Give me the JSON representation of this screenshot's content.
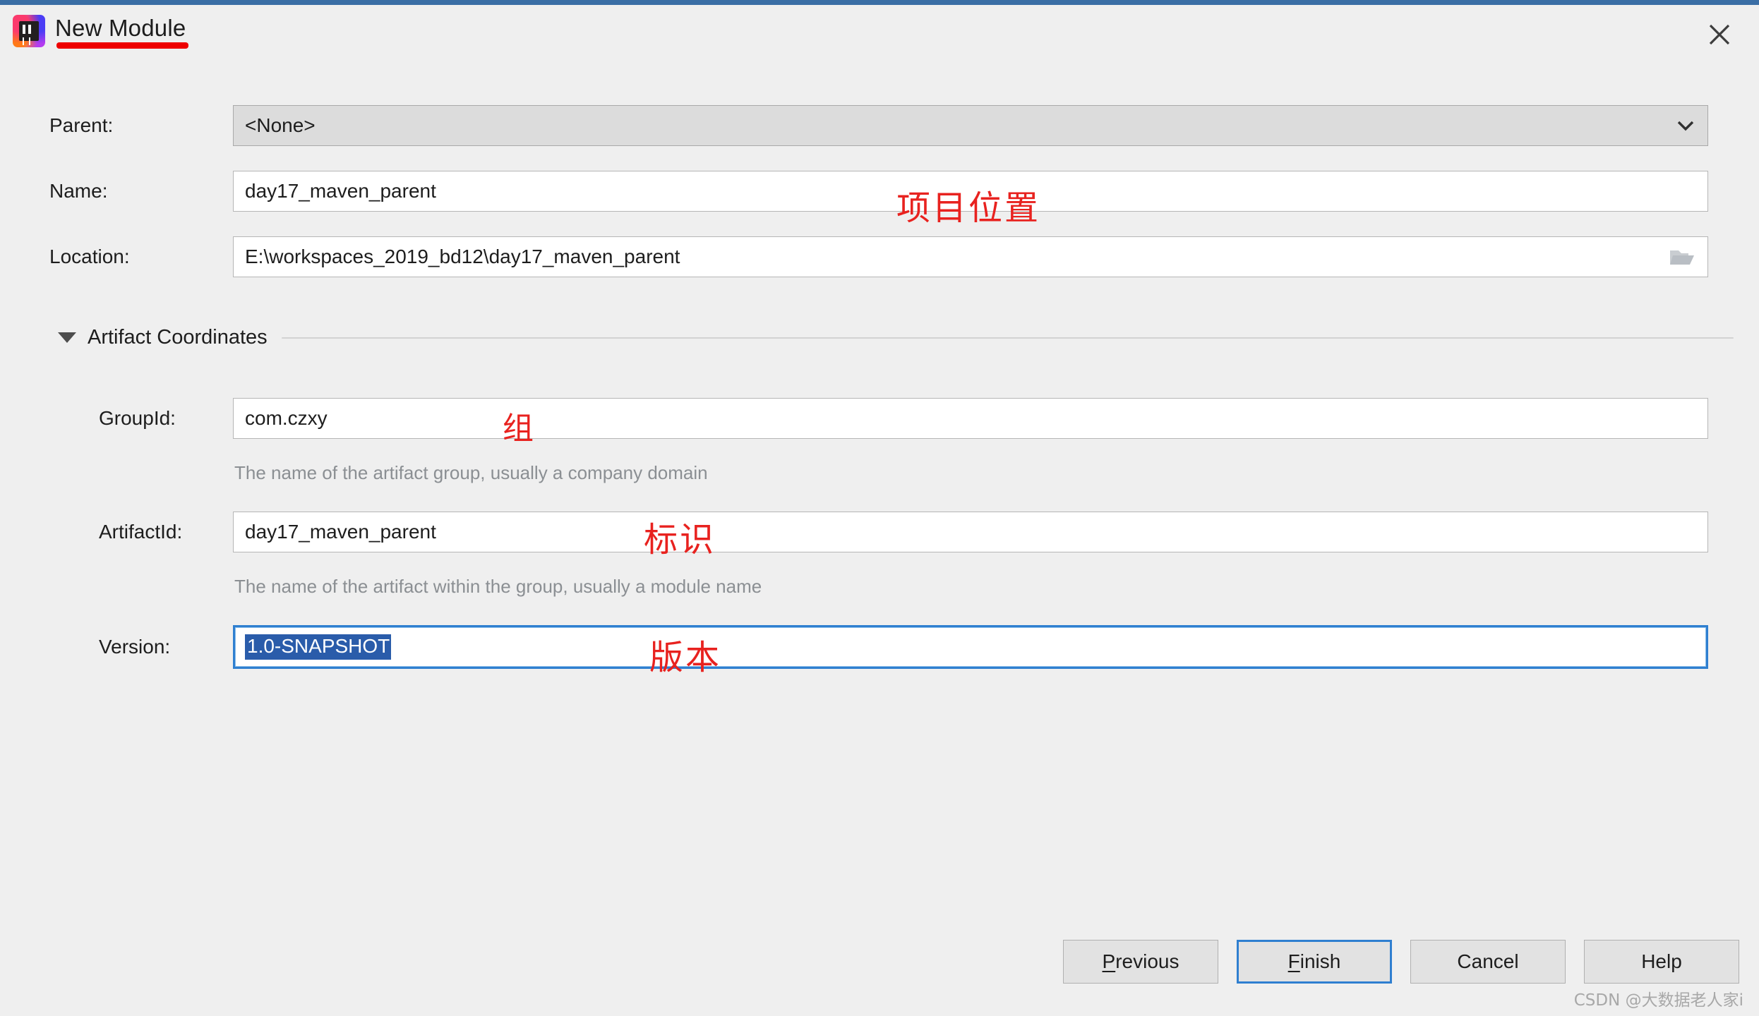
{
  "window": {
    "title": "New Module",
    "icon": "intellij-idea-icon",
    "close_label": "×",
    "accent_color": "#3a6ea5"
  },
  "form": {
    "parent": {
      "label": "Parent:",
      "value": "<None>",
      "icon": "chevron-down-icon"
    },
    "name": {
      "label": "Name:",
      "value": "day17_maven_parent"
    },
    "location": {
      "label": "Location:",
      "value": "E:\\workspaces_2019_bd12\\day17_maven_parent",
      "icon": "folder-open-icon"
    }
  },
  "artifact_section": {
    "label": "Artifact Coordinates",
    "expanded": true,
    "fields": {
      "group_id": {
        "label": "GroupId:",
        "value": "com.czxy",
        "hint": "The name of the artifact group, usually a company domain"
      },
      "artifact_id": {
        "label": "ArtifactId:",
        "value": "day17_maven_parent",
        "hint": "The name of the artifact within the group, usually a module name"
      },
      "version": {
        "label": "Version:",
        "value": "1.0-SNAPSHOT",
        "selected": true,
        "focused": true
      }
    }
  },
  "annotations": {
    "color": "#e8221f",
    "items": [
      {
        "text": "项目位置",
        "meaning": "project-location"
      },
      {
        "text": "组",
        "meaning": "group"
      },
      {
        "text": "标识",
        "meaning": "identifier"
      },
      {
        "text": "版本",
        "meaning": "version"
      }
    ]
  },
  "buttons": {
    "previous": {
      "label": "Previous",
      "mnemonic": "P"
    },
    "finish": {
      "label": "Finish",
      "mnemonic": "F",
      "is_default": true
    },
    "cancel": {
      "label": "Cancel"
    },
    "help": {
      "label": "Help"
    }
  },
  "watermark": "CSDN @大数据老人家i"
}
